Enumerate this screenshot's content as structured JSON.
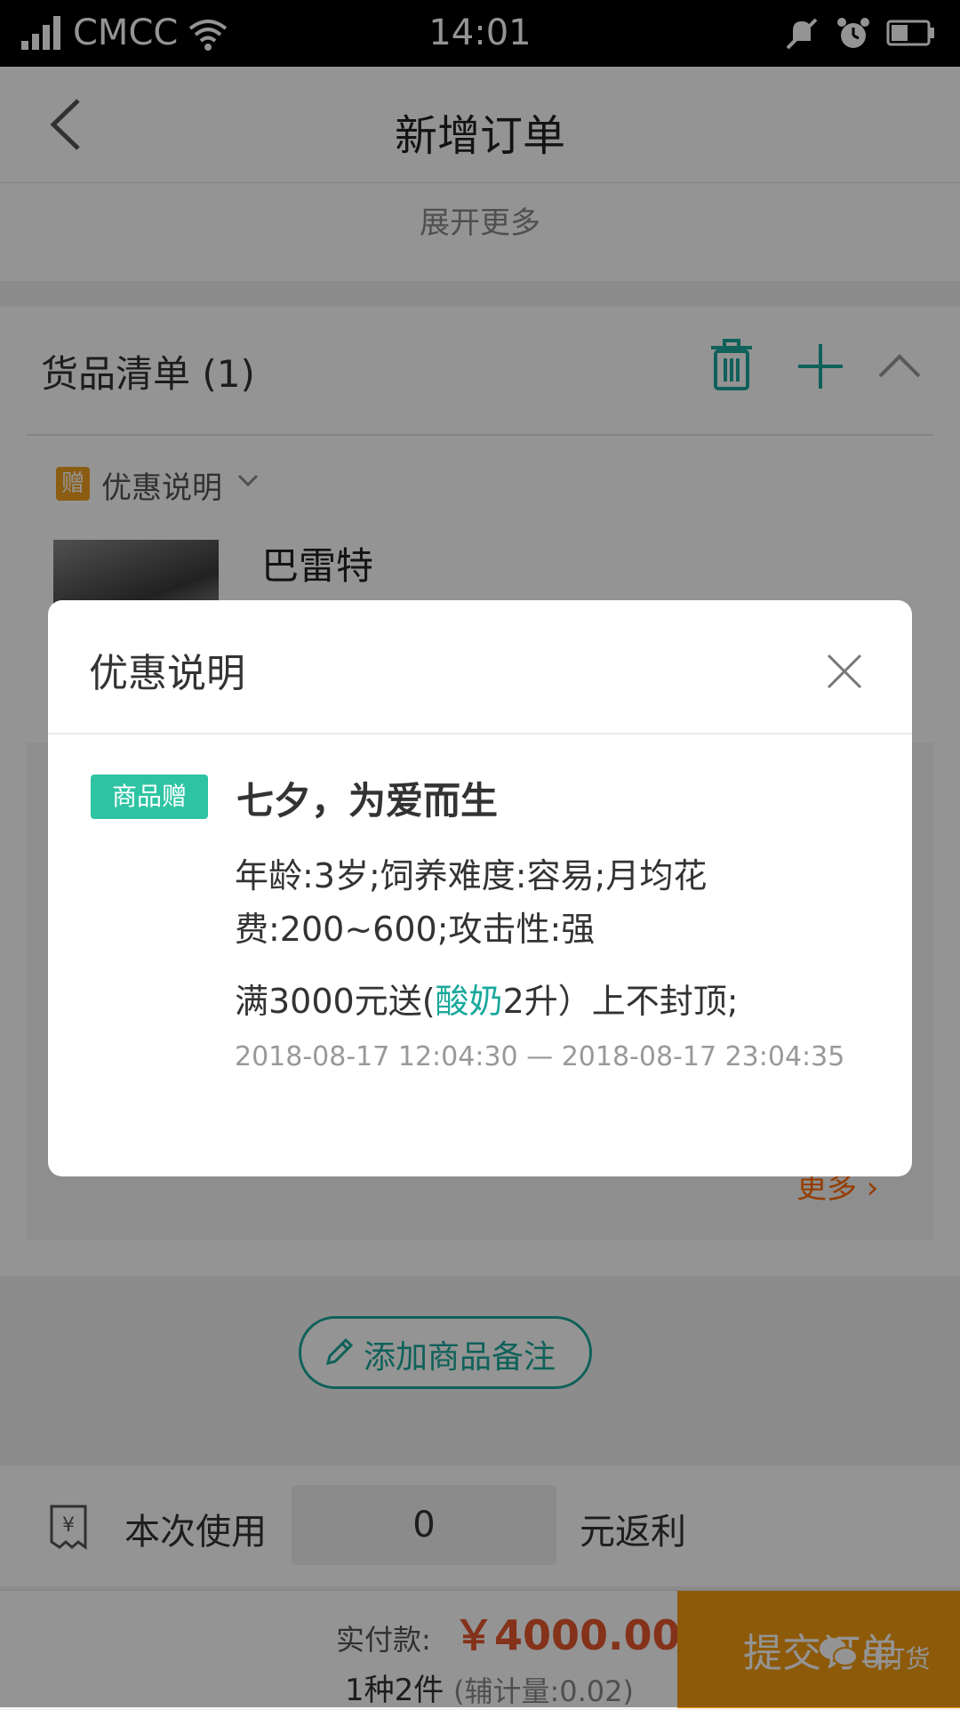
{
  "status_bar": {
    "carrier": "CMCC",
    "time": "14:01",
    "icons": [
      "signal-icon",
      "wifi-icon",
      "mute-icon",
      "alarm-icon",
      "battery-icon"
    ]
  },
  "header": {
    "title": "新增订单",
    "expand_more": "展开更多"
  },
  "goods": {
    "title": "货品清单 (1)",
    "promo_badge": "赠",
    "promo_label": "优惠说明",
    "product_name": "巴雷特",
    "more_link": "更多",
    "add_note": "添加商品备注"
  },
  "rebate": {
    "use_label": "本次使用",
    "value": "0",
    "unit": "元返利"
  },
  "bottom": {
    "pay_label": "实付款:",
    "pay_amount": "￥4000.00",
    "qty": "1种2件",
    "aux": "(辅计量:0.02)",
    "submit": "提交订单",
    "watermark": "U订货"
  },
  "modal": {
    "title": "优惠说明",
    "tag": "商品赠",
    "promo_title": "七夕，为爱而生",
    "description": "年龄:3岁;饲养难度:容易;月均花费:200~600;攻击性:强",
    "rule_prefix": "满3000元送(",
    "rule_highlight": "酸奶",
    "rule_suffix": "2升）上不封顶;",
    "date_range": "2018-08-17 12:04:30 — 2018-08-17 23:04:35"
  },
  "colors": {
    "accent": "#1aa89c",
    "gift_tag": "#2ec4a3",
    "price": "#e4572e",
    "submit": "#f39c12",
    "badge": "#f0a020"
  }
}
